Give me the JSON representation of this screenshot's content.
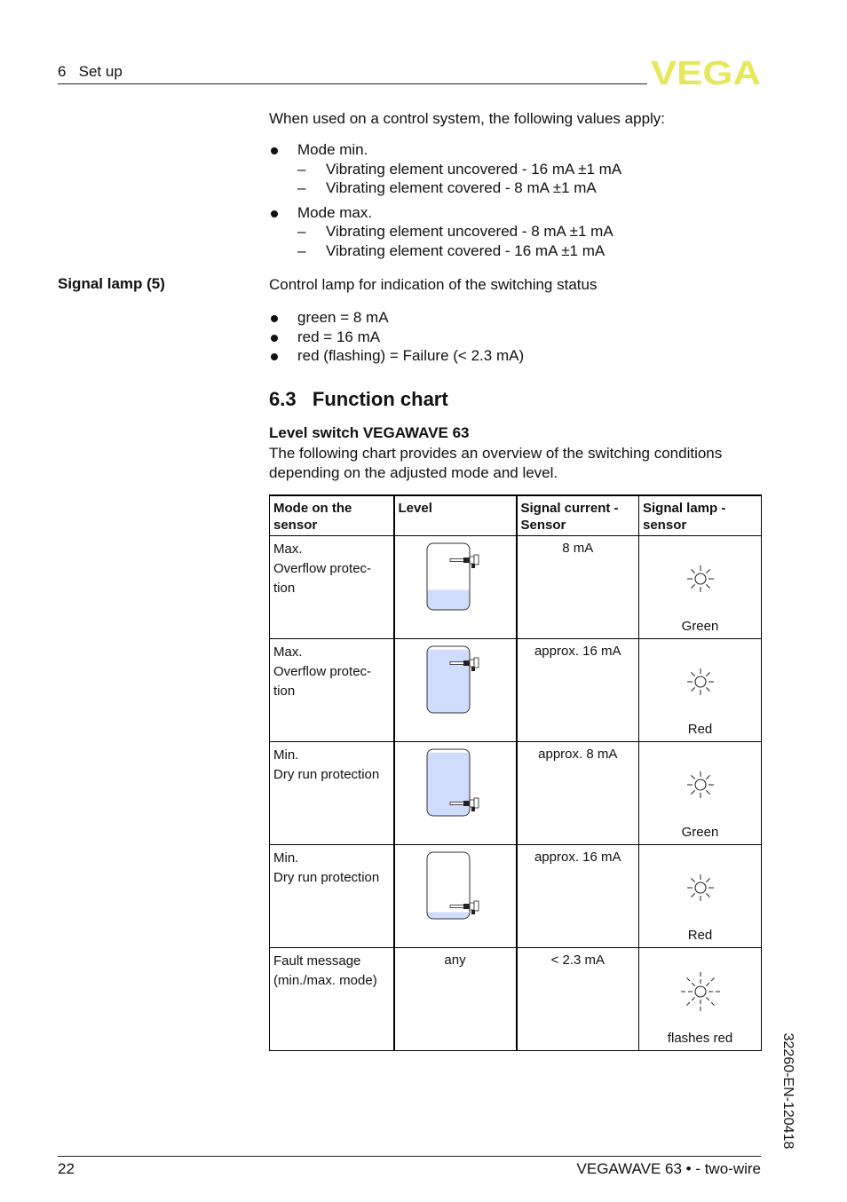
{
  "header": {
    "section": "6   Set up",
    "logo_text": "VEGA",
    "logo_color": "#e6e85a"
  },
  "control_system": {
    "intro": "When used on a control system, the following values apply:",
    "modes": [
      {
        "label": "Mode min.",
        "items": [
          "Vibrating element uncovered - 16 mA ±1 mA",
          "Vibrating element covered - 8 mA ±1 mA"
        ]
      },
      {
        "label": "Mode max.",
        "items": [
          "Vibrating element uncovered - 8 mA ±1 mA",
          "Vibrating element covered - 16 mA ±1 mA"
        ]
      }
    ]
  },
  "signal_lamp": {
    "side_label": "Signal lamp (5)",
    "description": "Control lamp for indication of the switching status",
    "items": [
      "green = 8 mA",
      "red = 16 mA",
      "red (flashing) = Failure (< 2.3 mA)"
    ]
  },
  "function_chart": {
    "heading": "6.3   Function chart",
    "subheading": "Level switch VEGAWAVE 63",
    "description": "The following chart provides an overview of the switching conditions depending on the adjusted mode and level.",
    "table": {
      "headers": [
        "Mode on the sensor",
        "Level",
        "Signal current - Sensor",
        "Signal lamp - sensor"
      ],
      "rows": [
        {
          "mode_line1": "Max.",
          "mode_line2": "Overflow protec-tion",
          "level": "low level, sensor at top (uncovered)",
          "level_text": "",
          "current": "8 mA",
          "lamp": "Green",
          "lamp_icon": "lamp-on-icon"
        },
        {
          "mode_line1": "Max.",
          "mode_line2": "Overflow protec-tion",
          "level": "full, sensor at top (covered)",
          "level_text": "",
          "current": "approx. 16 mA",
          "lamp": "Red",
          "lamp_icon": "lamp-on-icon"
        },
        {
          "mode_line1": "Min.",
          "mode_line2": "Dry run protection",
          "level": "full, sensor at bottom (covered)",
          "level_text": "",
          "current": "approx. 8 mA",
          "lamp": "Green",
          "lamp_icon": "lamp-on-icon"
        },
        {
          "mode_line1": "Min.",
          "mode_line2": "Dry run protection",
          "level": "empty, sensor at bottom (uncovered)",
          "level_text": "",
          "current": "approx. 16 mA",
          "lamp": "Red",
          "lamp_icon": "lamp-on-icon"
        },
        {
          "mode_line1": "Fault message",
          "mode_line2": "(min./max. mode)",
          "level": "any",
          "level_text": "any",
          "current": "< 2.3 mA",
          "lamp": "flashes red",
          "lamp_icon": "lamp-flashing-icon"
        }
      ]
    },
    "liquid_color": "#cfdcfb"
  },
  "side_doc_id": "32260-EN-120418",
  "footer": {
    "page_number": "22",
    "product": "VEGAWAVE 63 • - two-wire"
  }
}
